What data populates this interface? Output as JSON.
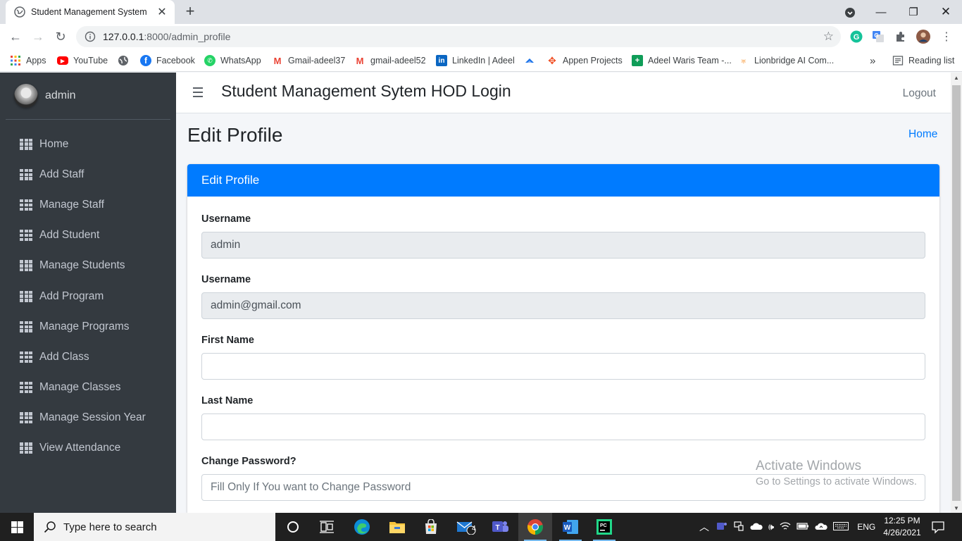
{
  "browser": {
    "tab_title": "Student Management System",
    "url_host": "127.0.0.1",
    "url_path": ":8000/admin_profile",
    "bookmarks": [
      {
        "label": "Apps",
        "icon": "apps-grid-icon"
      },
      {
        "label": "YouTube",
        "icon": "youtube-icon"
      },
      {
        "label": "",
        "icon": "globe-icon"
      },
      {
        "label": "Facebook",
        "icon": "facebook-icon"
      },
      {
        "label": "WhatsApp",
        "icon": "whatsapp-icon"
      },
      {
        "label": "Gmail-adeel37",
        "icon": "gmail-icon"
      },
      {
        "label": "gmail-adeel52",
        "icon": "gmail-icon"
      },
      {
        "label": "LinkedIn | Adeel",
        "icon": "linkedin-icon"
      },
      {
        "label": "",
        "icon": "cloud-icon"
      },
      {
        "label": "Appen Projects",
        "icon": "appen-icon"
      },
      {
        "label": "Adeel Waris Team -...",
        "icon": "sheets-icon"
      },
      {
        "label": "Lionbridge AI Com...",
        "icon": "lionbridge-icon"
      }
    ],
    "bookmarks_overflow": "»",
    "reading_list": "Reading list"
  },
  "sidebar": {
    "user_name": "admin",
    "items": [
      {
        "label": "Home"
      },
      {
        "label": "Add Staff"
      },
      {
        "label": "Manage Staff"
      },
      {
        "label": "Add Student"
      },
      {
        "label": "Manage Students"
      },
      {
        "label": "Add Program"
      },
      {
        "label": "Manage Programs"
      },
      {
        "label": "Add Class"
      },
      {
        "label": "Manage Classes"
      },
      {
        "label": "Manage Session Year"
      },
      {
        "label": "View Attendance"
      }
    ]
  },
  "header": {
    "title": "Student Management Sytem HOD Login",
    "logout": "Logout"
  },
  "content": {
    "page_title": "Edit Profile",
    "breadcrumb": "Home",
    "card_title": "Edit Profile",
    "fields": [
      {
        "label": "Username",
        "value": "admin",
        "placeholder": "",
        "readonly": true
      },
      {
        "label": "Username",
        "value": "admin@gmail.com",
        "placeholder": "",
        "readonly": true
      },
      {
        "label": "First Name",
        "value": "",
        "placeholder": "",
        "readonly": false
      },
      {
        "label": "Last Name",
        "value": "",
        "placeholder": "",
        "readonly": false
      },
      {
        "label": "Change Password?",
        "value": "",
        "placeholder": "Fill Only If You want to Change Password",
        "readonly": false
      }
    ]
  },
  "watermark": {
    "line1": "Activate Windows",
    "line2": "Go to Settings to activate Windows."
  },
  "taskbar": {
    "search_placeholder": "Type here to search",
    "mail_badge": "4",
    "language": "ENG",
    "time": "12:25 PM",
    "date": "4/26/2021"
  },
  "colors": {
    "primary": "#007bff",
    "sidebar_bg": "#343a40",
    "sidebar_text": "#c2c7d0",
    "readonly_bg": "#e9ecef"
  }
}
